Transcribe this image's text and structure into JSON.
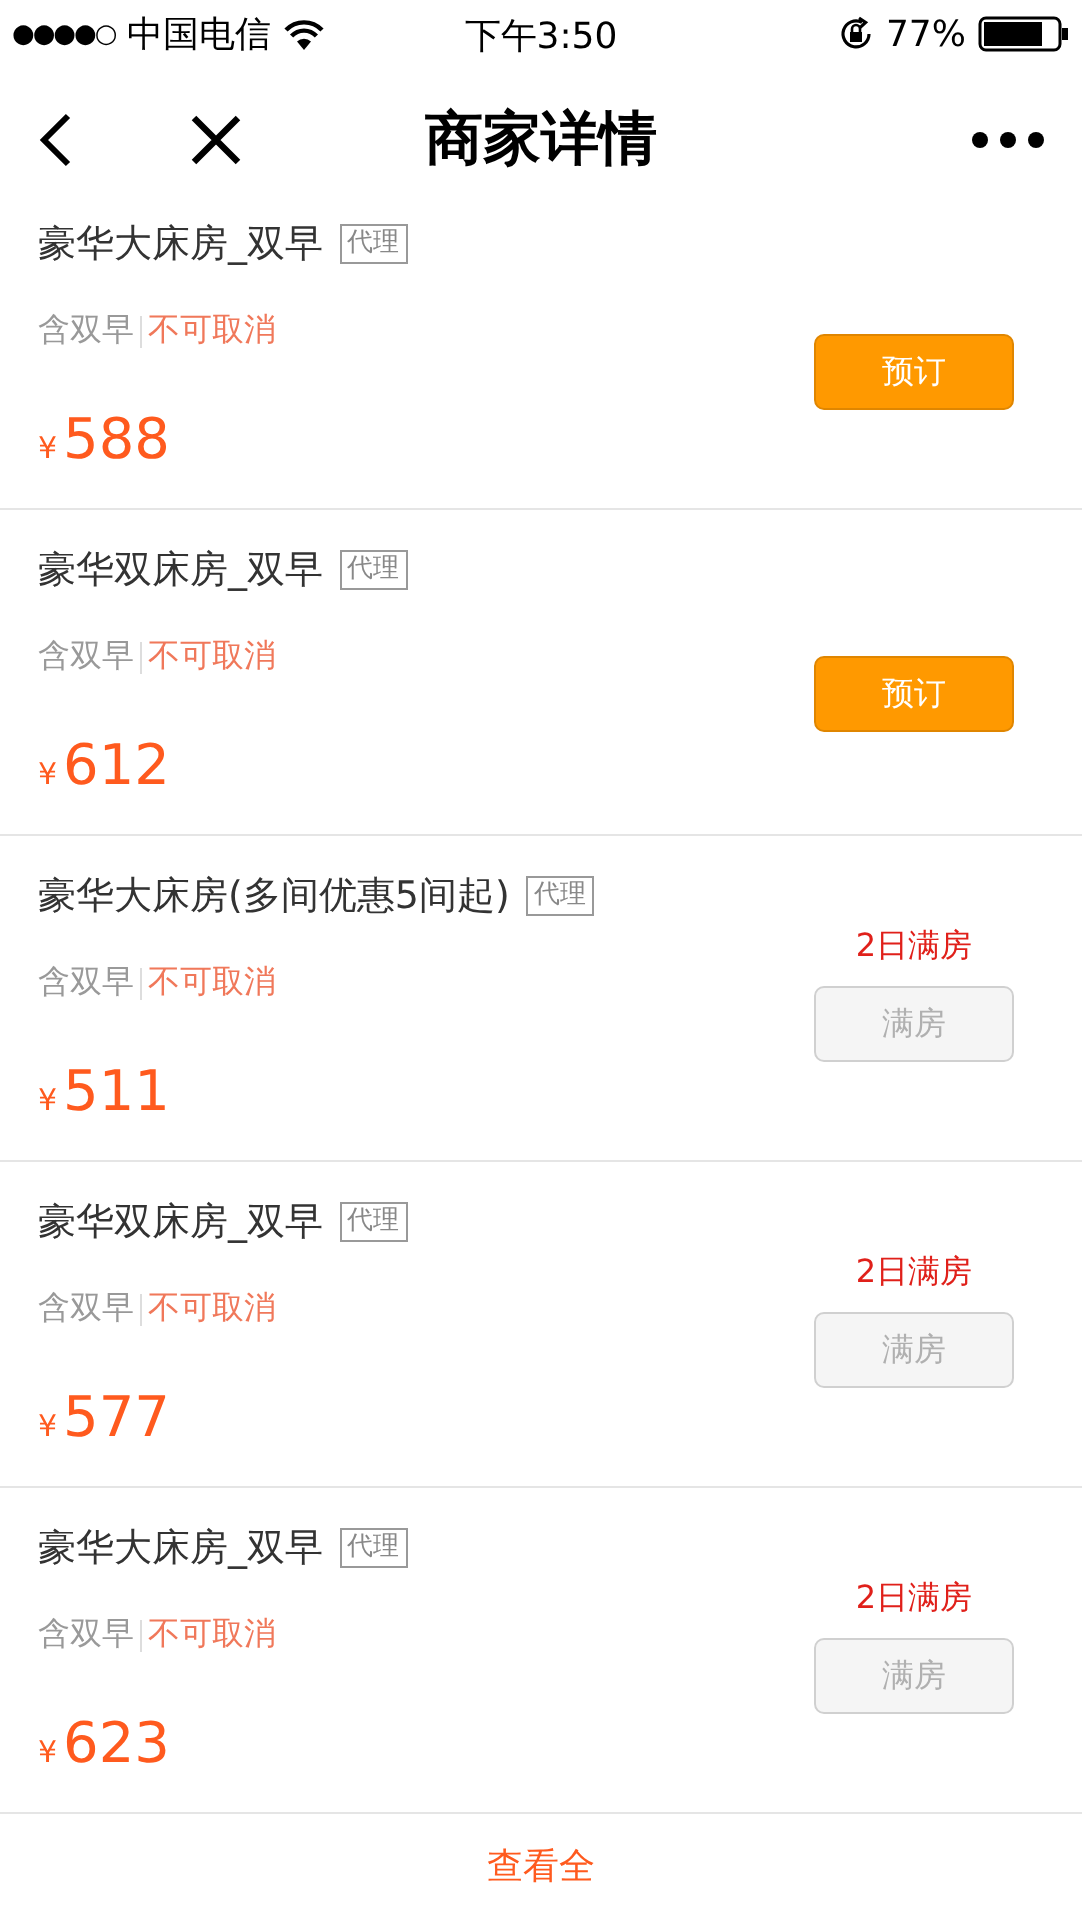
{
  "status_bar": {
    "signal": "●●●●○",
    "carrier": "中国电信",
    "time": "下午3:50",
    "battery": "77%"
  },
  "nav": {
    "title": "商家详情"
  },
  "rooms": [
    {
      "name": "豪华大床房_双早",
      "tag": "代理",
      "meal": "含双早",
      "cancel": "不可取消",
      "currency": "¥",
      "price": "588",
      "button": "预订",
      "disabled": false
    },
    {
      "name": "豪华双床房_双早",
      "tag": "代理",
      "meal": "含双早",
      "cancel": "不可取消",
      "currency": "¥",
      "price": "612",
      "button": "预订",
      "disabled": false
    },
    {
      "name": "豪华大床房(多间优惠5间起)",
      "tag": "代理",
      "meal": "含双早",
      "cancel": "不可取消",
      "currency": "¥",
      "price": "511",
      "notice": "2日满房",
      "button": "满房",
      "disabled": true
    },
    {
      "name": "豪华双床房_双早",
      "tag": "代理",
      "meal": "含双早",
      "cancel": "不可取消",
      "currency": "¥",
      "price": "577",
      "notice": "2日满房",
      "button": "满房",
      "disabled": true
    },
    {
      "name": "豪华大床房_双早",
      "tag": "代理",
      "meal": "含双早",
      "cancel": "不可取消",
      "currency": "¥",
      "price": "623",
      "notice": "2日满房",
      "button": "满房",
      "disabled": true
    }
  ],
  "footer_link": "查看全"
}
